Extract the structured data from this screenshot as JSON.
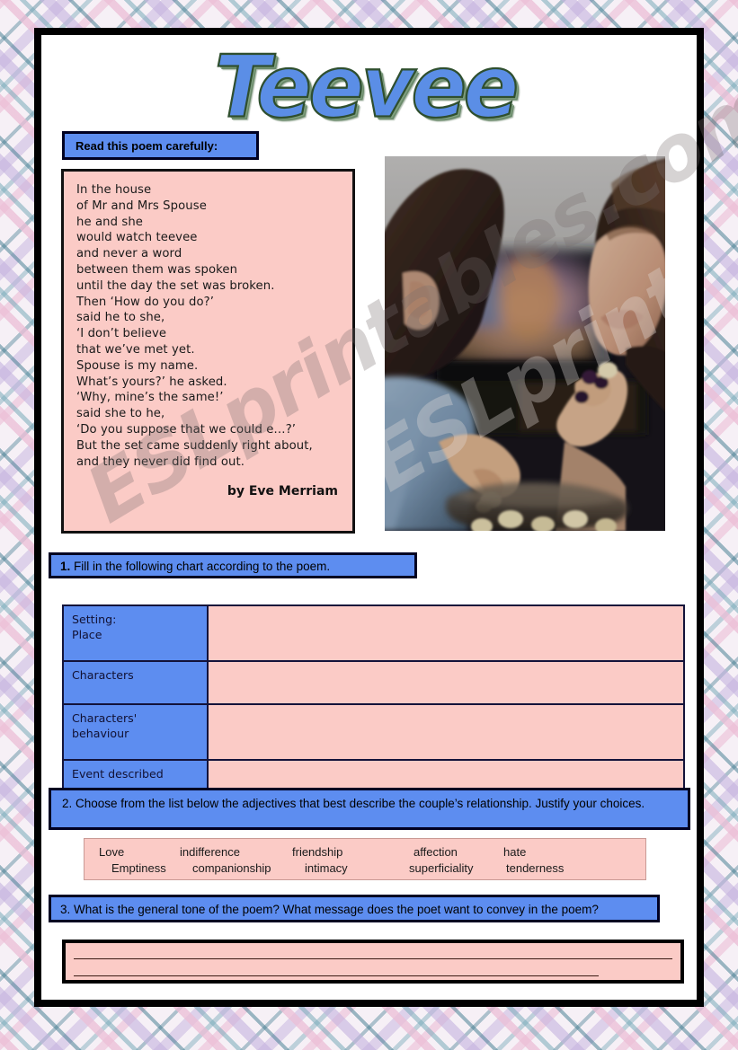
{
  "title": "Teevee",
  "instructions": {
    "read_poem": "Read this poem carefully:",
    "task1_number": "1.",
    "task1_text": "Fill in the following chart according to the poem.",
    "task2": "2. Choose from the list below the adjectives that best describe the couple’s relationship. Justify your choices.",
    "task3": "3. What is the general tone of the poem? What message does the poet want to convey in the poem?"
  },
  "poem": {
    "lines": "In the house\nof Mr and Mrs Spouse\nhe and she\nwould watch teevee\nand never a word\nbetween them was spoken\nuntil the day the set was broken.\nThen ‘How do you do?’\nsaid he to she,\n‘I don’t believe\nthat we’ve met yet.\nSpouse is my name.\nWhat’s yours?’ he asked.\n‘Why, mine’s the same!’\nsaid she to he,\n‘Do you suppose that we could e…?’\nBut the set came suddenly right about,\nand they never did find out.",
    "author": "by Eve Merriam"
  },
  "chart": {
    "rows": [
      {
        "label": "Setting:\nPlace",
        "answer": ""
      },
      {
        "label": "Characters",
        "answer": ""
      },
      {
        "label": "Characters'\nbehaviour",
        "answer": ""
      },
      {
        "label": "Event  described",
        "answer": ""
      }
    ]
  },
  "word_bank": {
    "row1": [
      "Love",
      "indifference",
      "friendship",
      "affection",
      "hate"
    ],
    "row2": [
      "Emptiness",
      "companionship",
      "intimacy",
      "superficiality",
      "tenderness"
    ]
  },
  "photo": {
    "alt": "Couple watching television at home while eating popcorn"
  },
  "watermark": {
    "text": "ESLprintables.com"
  },
  "colors": {
    "blue_bar": "#5d8df0",
    "pink_fill": "#fbcbc6",
    "frame": "#000000",
    "border_navy": "#13133a"
  }
}
